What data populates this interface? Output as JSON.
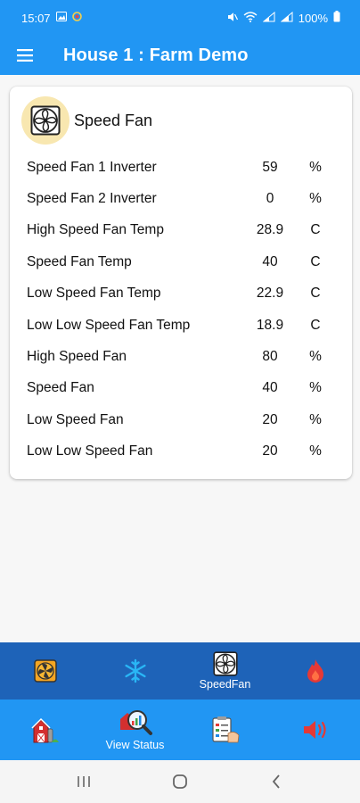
{
  "status_bar": {
    "time": "15:07",
    "battery": "100%"
  },
  "app_bar": {
    "title": "House 1 : Farm Demo"
  },
  "card": {
    "title": "Speed Fan",
    "rows": [
      {
        "label": "Speed Fan 1 Inverter",
        "value": "59",
        "unit": "%"
      },
      {
        "label": "Speed Fan 2 Inverter",
        "value": "0",
        "unit": "%"
      },
      {
        "label": "High Speed Fan Temp",
        "value": "28.9",
        "unit": "C"
      },
      {
        "label": "Speed Fan Temp",
        "value": "40",
        "unit": "C"
      },
      {
        "label": "Low Speed Fan Temp",
        "value": "22.9",
        "unit": "C"
      },
      {
        "label": "Low Low Speed Fan Temp",
        "value": "18.9",
        "unit": "C"
      },
      {
        "label": "High Speed Fan",
        "value": "80",
        "unit": "%"
      },
      {
        "label": "Speed Fan",
        "value": "40",
        "unit": "%"
      },
      {
        "label": "Low Speed Fan",
        "value": "20",
        "unit": "%"
      },
      {
        "label": "Low Low Speed Fan",
        "value": "20",
        "unit": "%"
      }
    ]
  },
  "tabs_top": [
    {
      "icon": "ventilation-fan-icon",
      "label": ""
    },
    {
      "icon": "snowflake-icon",
      "label": ""
    },
    {
      "icon": "speed-fan-icon",
      "label": "SpeedFan"
    },
    {
      "icon": "flame-icon",
      "label": ""
    }
  ],
  "tabs_bottom": [
    {
      "icon": "barn-icon",
      "label": ""
    },
    {
      "icon": "magnifier-chart-icon",
      "label": "View Status"
    },
    {
      "icon": "clipboard-icon",
      "label": ""
    },
    {
      "icon": "speaker-icon",
      "label": ""
    }
  ],
  "colors": {
    "primary": "#2196f3",
    "tab_bar_dark": "#1e63b8",
    "card_icon_bg": "#f8e7b0"
  }
}
